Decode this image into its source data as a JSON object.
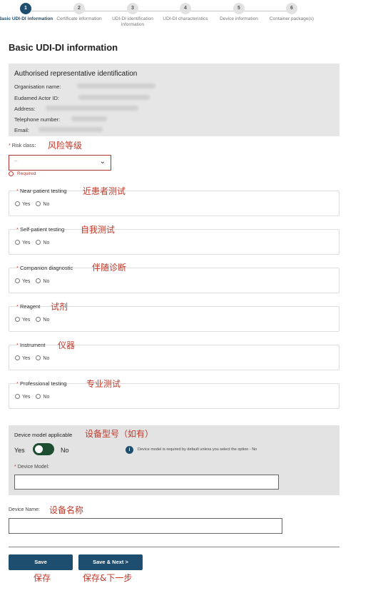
{
  "stepper": {
    "steps": [
      {
        "num": "1",
        "label": "Basic UDI-DI information"
      },
      {
        "num": "2",
        "label": "Certificate information"
      },
      {
        "num": "3",
        "label": "UDI-DI identification information"
      },
      {
        "num": "4",
        "label": "UDI-DI characteristics"
      },
      {
        "num": "5",
        "label": "Device information"
      },
      {
        "num": "6",
        "label": "Container package(s)"
      }
    ]
  },
  "page_title": "Basic UDI-DI information",
  "authorised_rep": {
    "title": "Authorised representative identification",
    "rows": [
      "Organisation name:",
      "Eudamed Actor ID:",
      "Address:",
      "Telephone number:",
      "Email:"
    ]
  },
  "risk": {
    "label": "Risk class:",
    "value": "--",
    "required": "Required",
    "note": "风险等级"
  },
  "questions": [
    {
      "label": "Near-patient testing",
      "note": "近患者测试",
      "yes": "Yes",
      "no": "No"
    },
    {
      "label": "Self-patient testing",
      "note": "自我测试",
      "yes": "Yes",
      "no": "No"
    },
    {
      "label": "Companion diagnostic",
      "note": "伴随诊断",
      "yes": "Yes",
      "no": "No"
    },
    {
      "label": "Reagent",
      "note": "试剂",
      "yes": "Yes",
      "no": "No"
    },
    {
      "label": "Instrument",
      "note": "仪器",
      "yes": "Yes",
      "no": "No"
    },
    {
      "label": "Professional testing",
      "note": "专业测试",
      "yes": "Yes",
      "no": "No"
    }
  ],
  "device_model": {
    "title": "Device model applicable",
    "note": "设备型号（如有）",
    "yes": "Yes",
    "no": "No",
    "info": "Device model is required by default unless you select the option - No",
    "field_label": "Device Model:",
    "value": ""
  },
  "device_name": {
    "label": "Device Name:",
    "note": "设备名称",
    "value": ""
  },
  "buttons": {
    "save": "Save",
    "save_next": "Save & Next  >",
    "save_note": "保存",
    "save_next_note": "保存&下一步"
  },
  "colors": {
    "primary": "#1d4e6f",
    "toggle": "#1d4e2f",
    "annotation": "#c0392b"
  }
}
